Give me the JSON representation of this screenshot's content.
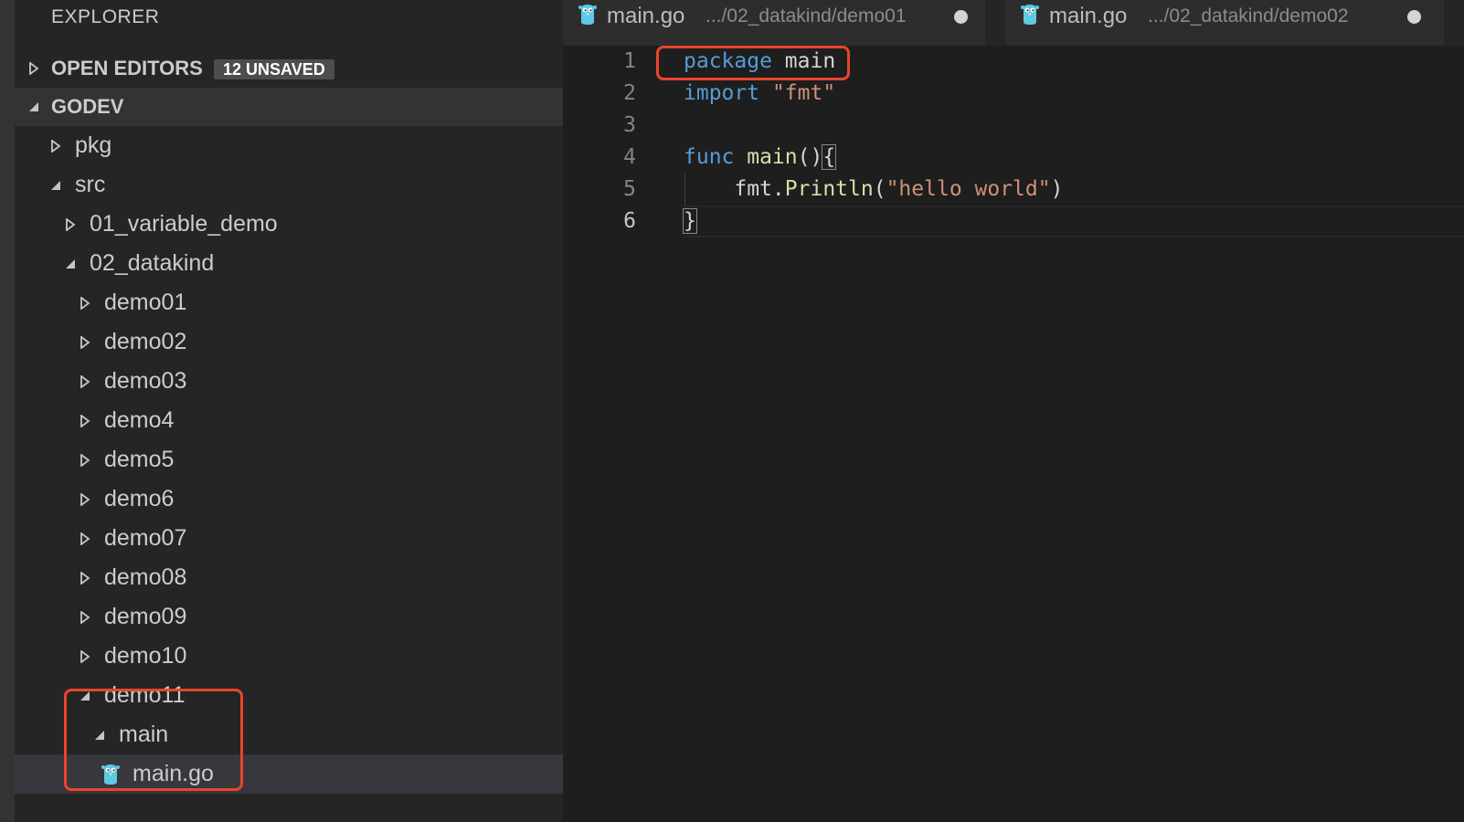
{
  "explorer": {
    "title": "EXPLORER",
    "open_editors": {
      "label": "OPEN EDITORS",
      "badge": "12 UNSAVED"
    },
    "workspace": {
      "label": "GODEV"
    },
    "tree": [
      {
        "label": "pkg",
        "expanded": false
      },
      {
        "label": "src",
        "expanded": true
      },
      {
        "label": "01_variable_demo",
        "expanded": false
      },
      {
        "label": "02_datakind",
        "expanded": true
      },
      {
        "label": "demo01",
        "expanded": false
      },
      {
        "label": "demo02",
        "expanded": false
      },
      {
        "label": "demo03",
        "expanded": false
      },
      {
        "label": "demo4",
        "expanded": false
      },
      {
        "label": "demo5",
        "expanded": false
      },
      {
        "label": "demo6",
        "expanded": false
      },
      {
        "label": "demo07",
        "expanded": false
      },
      {
        "label": "demo08",
        "expanded": false
      },
      {
        "label": "demo09",
        "expanded": false
      },
      {
        "label": "demo10",
        "expanded": false
      },
      {
        "label": "demo11",
        "expanded": true
      },
      {
        "label": "main",
        "expanded": true
      },
      {
        "label": "main.go",
        "icon": "gopher-icon",
        "selected": true
      }
    ]
  },
  "tabs": [
    {
      "name": "main.go",
      "path": ".../02_datakind/demo01",
      "icon": "gopher-icon",
      "dirty": true
    },
    {
      "name": "main.go",
      "path": ".../02_datakind/demo02",
      "icon": "gopher-icon",
      "dirty": true
    }
  ],
  "editor": {
    "line_numbers": [
      "1",
      "2",
      "3",
      "4",
      "5",
      "6"
    ],
    "active_line": 6,
    "code": {
      "l1_keyword": "package",
      "l1_name": " main",
      "l2_keyword": "import",
      "l2_string": " \"fmt\"",
      "l4_keyword": "func",
      "l4_fn": " main",
      "l4_rest": "()",
      "l4_brace": "{",
      "l5_indent": "    ",
      "l5_obj": "fmt.",
      "l5_fn": "Println",
      "l5_open": "(",
      "l5_string": "\"hello world\"",
      "l5_close": ")",
      "l6_brace": "}"
    }
  },
  "colors": {
    "annotation": "#e8452c",
    "gopher": "#5dc9e2",
    "keyword": "#569cd6",
    "string": "#ce9178",
    "function": "#dcdcaa"
  }
}
